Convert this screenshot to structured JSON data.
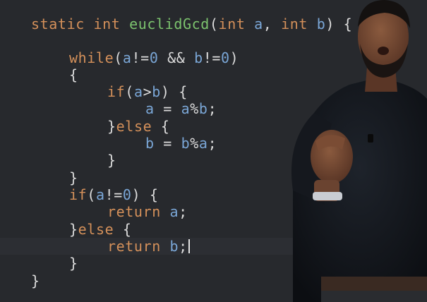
{
  "code": {
    "lines": [
      {
        "tokens": [
          {
            "t": "static",
            "c": "kw"
          },
          {
            "t": " ",
            "c": "pl"
          },
          {
            "t": "int",
            "c": "kw"
          },
          {
            "t": " ",
            "c": "pl"
          },
          {
            "t": "euclidGcd",
            "c": "fn"
          },
          {
            "t": "(",
            "c": "pl"
          },
          {
            "t": "int",
            "c": "kw"
          },
          {
            "t": " ",
            "c": "pl"
          },
          {
            "t": "a",
            "c": "var"
          },
          {
            "t": ", ",
            "c": "pl"
          },
          {
            "t": "int",
            "c": "kw"
          },
          {
            "t": " ",
            "c": "pl"
          },
          {
            "t": "b",
            "c": "var"
          },
          {
            "t": ") {",
            "c": "pl"
          }
        ]
      },
      {
        "tokens": [
          {
            "t": "while",
            "c": "kw"
          },
          {
            "t": "(",
            "c": "pl"
          },
          {
            "t": "a",
            "c": "var"
          },
          {
            "t": "!=",
            "c": "pl"
          },
          {
            "t": "0",
            "c": "num"
          },
          {
            "t": " && ",
            "c": "pl"
          },
          {
            "t": "b",
            "c": "var"
          },
          {
            "t": "!=",
            "c": "pl"
          },
          {
            "t": "0",
            "c": "num"
          },
          {
            "t": ")",
            "c": "pl"
          }
        ]
      },
      {
        "tokens": [
          {
            "t": "{",
            "c": "pl"
          }
        ]
      },
      {
        "tokens": [
          {
            "t": "if",
            "c": "kw"
          },
          {
            "t": "(",
            "c": "pl"
          },
          {
            "t": "a",
            "c": "var"
          },
          {
            "t": ">",
            "c": "pl"
          },
          {
            "t": "b",
            "c": "var"
          },
          {
            "t": ") {",
            "c": "pl"
          }
        ]
      },
      {
        "tokens": [
          {
            "t": "a",
            "c": "var"
          },
          {
            "t": " = ",
            "c": "pl"
          },
          {
            "t": "a",
            "c": "var"
          },
          {
            "t": "%",
            "c": "pl"
          },
          {
            "t": "b",
            "c": "var"
          },
          {
            "t": ";",
            "c": "pl"
          }
        ]
      },
      {
        "tokens": [
          {
            "t": "}",
            "c": "pl"
          },
          {
            "t": "else",
            "c": "kw"
          },
          {
            "t": " {",
            "c": "pl"
          }
        ]
      },
      {
        "tokens": [
          {
            "t": "b",
            "c": "var"
          },
          {
            "t": " = ",
            "c": "pl"
          },
          {
            "t": "b",
            "c": "var"
          },
          {
            "t": "%",
            "c": "pl"
          },
          {
            "t": "a",
            "c": "var"
          },
          {
            "t": ";",
            "c": "pl"
          }
        ]
      },
      {
        "tokens": [
          {
            "t": "}",
            "c": "pl"
          }
        ]
      },
      {
        "tokens": [
          {
            "t": "}",
            "c": "pl"
          }
        ]
      },
      {
        "tokens": [
          {
            "t": "if",
            "c": "kw"
          },
          {
            "t": "(",
            "c": "pl"
          },
          {
            "t": "a",
            "c": "var"
          },
          {
            "t": "!=",
            "c": "pl"
          },
          {
            "t": "0",
            "c": "num"
          },
          {
            "t": ") {",
            "c": "pl"
          }
        ]
      },
      {
        "tokens": [
          {
            "t": "return",
            "c": "kw"
          },
          {
            "t": " ",
            "c": "pl"
          },
          {
            "t": "a",
            "c": "var"
          },
          {
            "t": ";",
            "c": "pl"
          }
        ]
      },
      {
        "tokens": [
          {
            "t": "}",
            "c": "pl"
          },
          {
            "t": "else",
            "c": "kw"
          },
          {
            "t": " {",
            "c": "pl"
          }
        ]
      },
      {
        "tokens": [
          {
            "t": "return",
            "c": "kw"
          },
          {
            "t": " ",
            "c": "pl"
          },
          {
            "t": "b",
            "c": "var"
          },
          {
            "t": ";",
            "c": "pl"
          }
        ]
      },
      {
        "tokens": [
          {
            "t": "}",
            "c": "pl"
          }
        ]
      },
      {
        "tokens": [
          {
            "t": "}",
            "c": "pl"
          }
        ]
      }
    ]
  },
  "colors": {
    "background": "#27292d",
    "keyword": "#d4905a",
    "function": "#7cc36e",
    "identifier": "#7aa6d6",
    "plain": "#dcdcdc"
  }
}
